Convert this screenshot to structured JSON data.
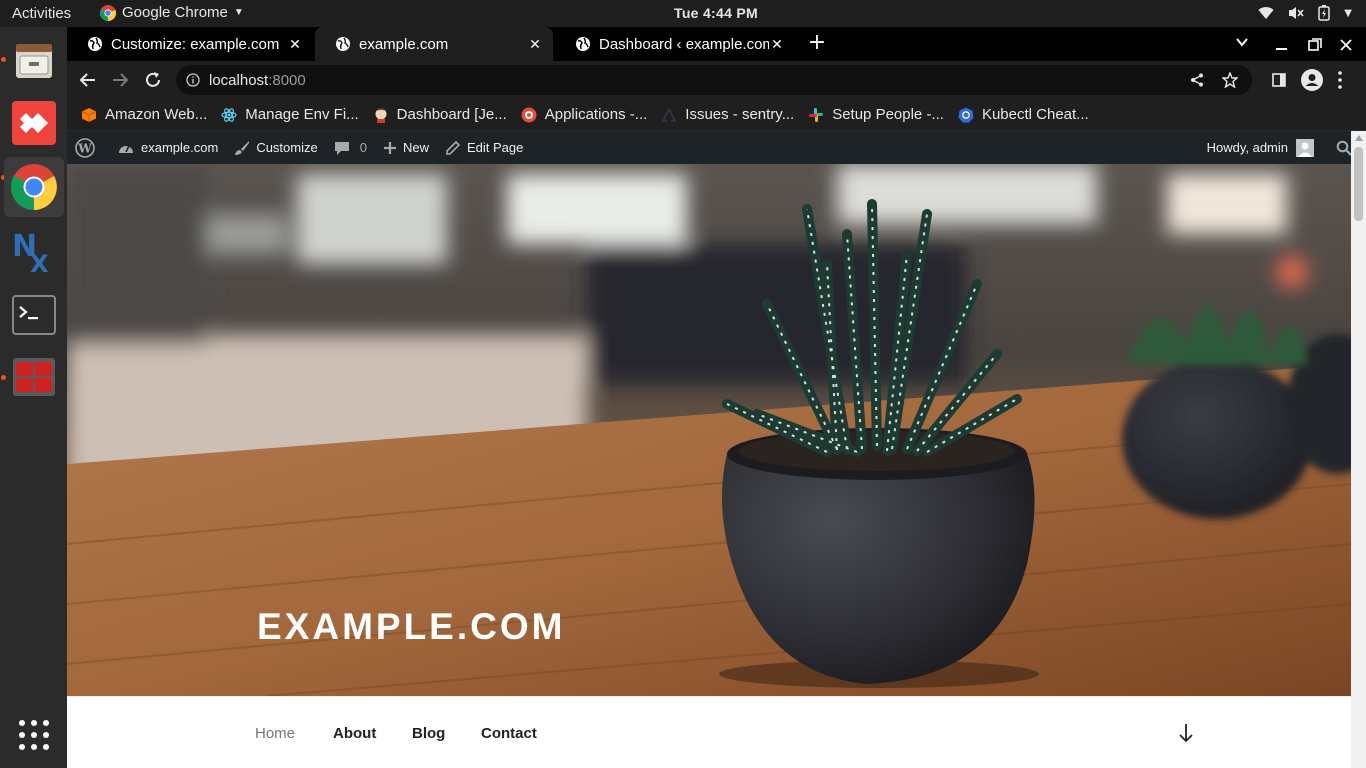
{
  "system": {
    "activities": "Activities",
    "app_name": "Google Chrome",
    "clock": "Tue  4:44 PM"
  },
  "browser": {
    "tabs": [
      {
        "label": "Customize: example.com",
        "active": false
      },
      {
        "label": "example.com",
        "active": true
      },
      {
        "label": "Dashboard ‹ example.com",
        "active": false
      }
    ],
    "address_host": "localhost",
    "address_port": ":8000",
    "bookmarks": [
      {
        "label": "Amazon Web...",
        "icon": "aws-cube-icon",
        "color": "#ff9900"
      },
      {
        "label": "Manage Env Fi...",
        "icon": "react-atom-icon",
        "color": "#61dafb"
      },
      {
        "label": "Dashboard [Je...",
        "icon": "jenkins-icon",
        "color": "#d33833"
      },
      {
        "label": "Applications -...",
        "icon": "app-logo-icon",
        "color": "#e74c3c"
      },
      {
        "label": "Issues - sentry...",
        "icon": "sentry-icon",
        "color": "#362d59"
      },
      {
        "label": "Setup People -...",
        "icon": "slack-icon",
        "color": "#e01e5a"
      },
      {
        "label": "Kubectl Cheat...",
        "icon": "kubernetes-icon",
        "color": "#326ce5"
      }
    ]
  },
  "wp_admin_bar": {
    "site": "example.com",
    "customize": "Customize",
    "comments_count": "0",
    "new": "New",
    "edit_page": "Edit Page",
    "howdy": "Howdy, admin"
  },
  "site": {
    "title": "EXAMPLE.COM",
    "nav": [
      "Home",
      "About",
      "Blog",
      "Contact"
    ]
  }
}
